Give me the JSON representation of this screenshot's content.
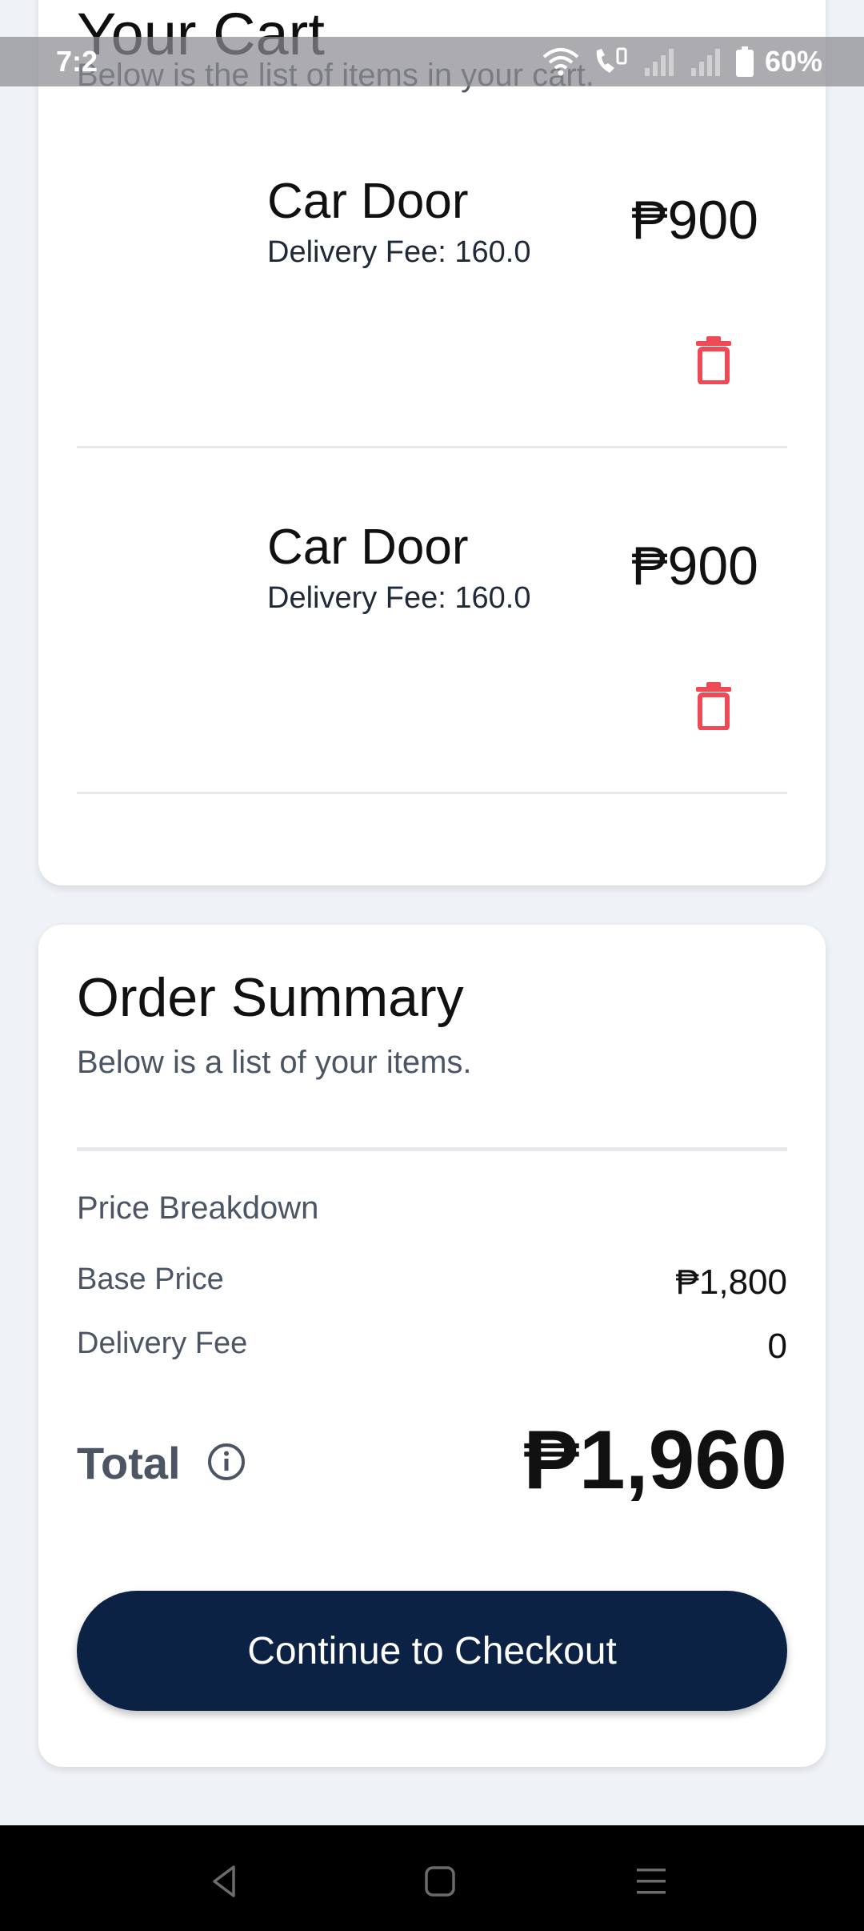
{
  "status_bar": {
    "time": "7:2",
    "battery": "60%"
  },
  "cart": {
    "title": "Your Cart",
    "subtitle": "Below is the list of items in your cart.",
    "items": [
      {
        "name": "Car Door",
        "delivery_fee": "Delivery Fee: 160.0",
        "price": "₱900",
        "delete_icon": "trash-icon"
      },
      {
        "name": "Car Door",
        "delivery_fee": "Delivery Fee: 160.0",
        "price": "₱900",
        "delete_icon": "trash-icon"
      }
    ]
  },
  "summary": {
    "title": "Order Summary",
    "subtitle": "Below is a list of your items.",
    "breakdown_label": "Price Breakdown",
    "base_price_label": "Base Price",
    "base_price_value": "₱1,800",
    "delivery_fee_label": "Delivery Fee",
    "delivery_fee_value": "0",
    "total_label": "Total",
    "total_value": "₱1,960",
    "checkout_label": "Continue to Checkout"
  },
  "colors": {
    "accent_button": "#0b2245",
    "delete_icon": "#ef4a55",
    "background": "#eff2f6"
  },
  "icons": {
    "nav_back": "back-triangle-icon",
    "nav_home": "home-square-icon",
    "nav_recent": "recent-apps-icon",
    "info": "info-circle-icon"
  }
}
